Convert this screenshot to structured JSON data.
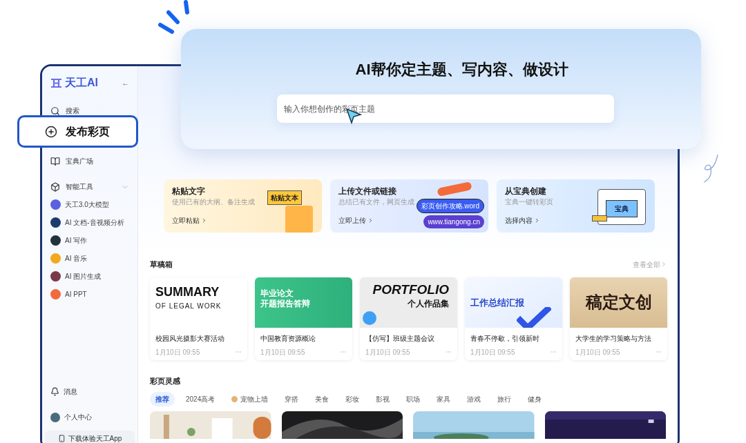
{
  "hero": {
    "title": "AI帮你定主题、写内容、做设计",
    "input": {
      "placeholder": "输入你想创作的彩页主题"
    }
  },
  "callout": {
    "label": "发布彩页"
  },
  "sidebar": {
    "logo": "天工AI",
    "collapse": "←",
    "items": [
      {
        "label": "搜索"
      },
      {
        "label": "宝典广场"
      }
    ],
    "group": {
      "label": "智能工具",
      "expanded": true,
      "tools": [
        {
          "label": "天工3.0大模型",
          "color": "#5b5fe0"
        },
        {
          "label": "AI 文档-音视频分析",
          "color": "#1f3b6e"
        },
        {
          "label": "AI 写作",
          "color": "#24323a"
        },
        {
          "label": "AI 音乐",
          "color": "#f2a91d"
        },
        {
          "label": "AI 图片生成",
          "color": "#7a3a4a"
        },
        {
          "label": "AI PPT",
          "color": "#f26a3b"
        }
      ]
    },
    "bottom": [
      {
        "label": "消息",
        "kind": "bell"
      },
      {
        "label": "个人中心",
        "kind": "avatar"
      }
    ],
    "download": "下载体验天工App"
  },
  "features": [
    {
      "title": "粘贴文字",
      "subtitle": "使用已有的大纲、备注生成",
      "action": "立即粘贴",
      "kind": "paste",
      "tags": [
        "粘贴文本"
      ]
    },
    {
      "title": "上传文件或链接",
      "subtitle": "总结已有文件，网页生成",
      "action": "立即上传",
      "kind": "upload",
      "tags": [
        "彩页创作攻略.word",
        "www.tiangong.cn"
      ]
    },
    {
      "title": "从宝典创建",
      "subtitle": "宝典一键转彩页",
      "action": "选择内容",
      "kind": "book",
      "tags": [
        "宝典"
      ]
    }
  ],
  "drafts": {
    "title": "草稿箱",
    "more": "查看全部",
    "items": [
      {
        "name": "校园风光摄影大赛活动",
        "date": "1月10日 09:55",
        "kind": "summary",
        "cover": [
          "SUMMARY",
          "OF LEGAL WORK"
        ]
      },
      {
        "name": "中国教育资源概论",
        "date": "1月10日 09:55",
        "kind": "green",
        "cover": [
          "毕业论文",
          "开题报告答辩"
        ]
      },
      {
        "name": "【仿写】班级主题会议",
        "date": "1月10日 09:55",
        "kind": "portfolio",
        "cover": [
          "PORTFOLIO",
          "个人作品集"
        ]
      },
      {
        "name": "青春不停歇，引领新时",
        "date": "1月10日 09:55",
        "kind": "report",
        "cover": [
          "工作总结汇报"
        ]
      },
      {
        "name": "大学生的学习策略与方法",
        "date": "1月10日 09:55",
        "kind": "brush",
        "cover": [
          "稿定文创"
        ]
      }
    ]
  },
  "inspiration": {
    "title": "彩页灵感",
    "tabs": [
      {
        "label": "推荐",
        "selected": true
      },
      {
        "label": "2024高考",
        "selected": false
      },
      {
        "label": "宠物上墙",
        "selected": false,
        "kind": "pet"
      },
      {
        "label": "穿搭",
        "selected": false
      },
      {
        "label": "美食",
        "selected": false
      },
      {
        "label": "彩妆",
        "selected": false
      },
      {
        "label": "影视",
        "selected": false
      },
      {
        "label": "职场",
        "selected": false
      },
      {
        "label": "家具",
        "selected": false
      },
      {
        "label": "游戏",
        "selected": false
      },
      {
        "label": "旅行",
        "selected": false
      },
      {
        "label": "健身",
        "selected": false
      }
    ]
  }
}
